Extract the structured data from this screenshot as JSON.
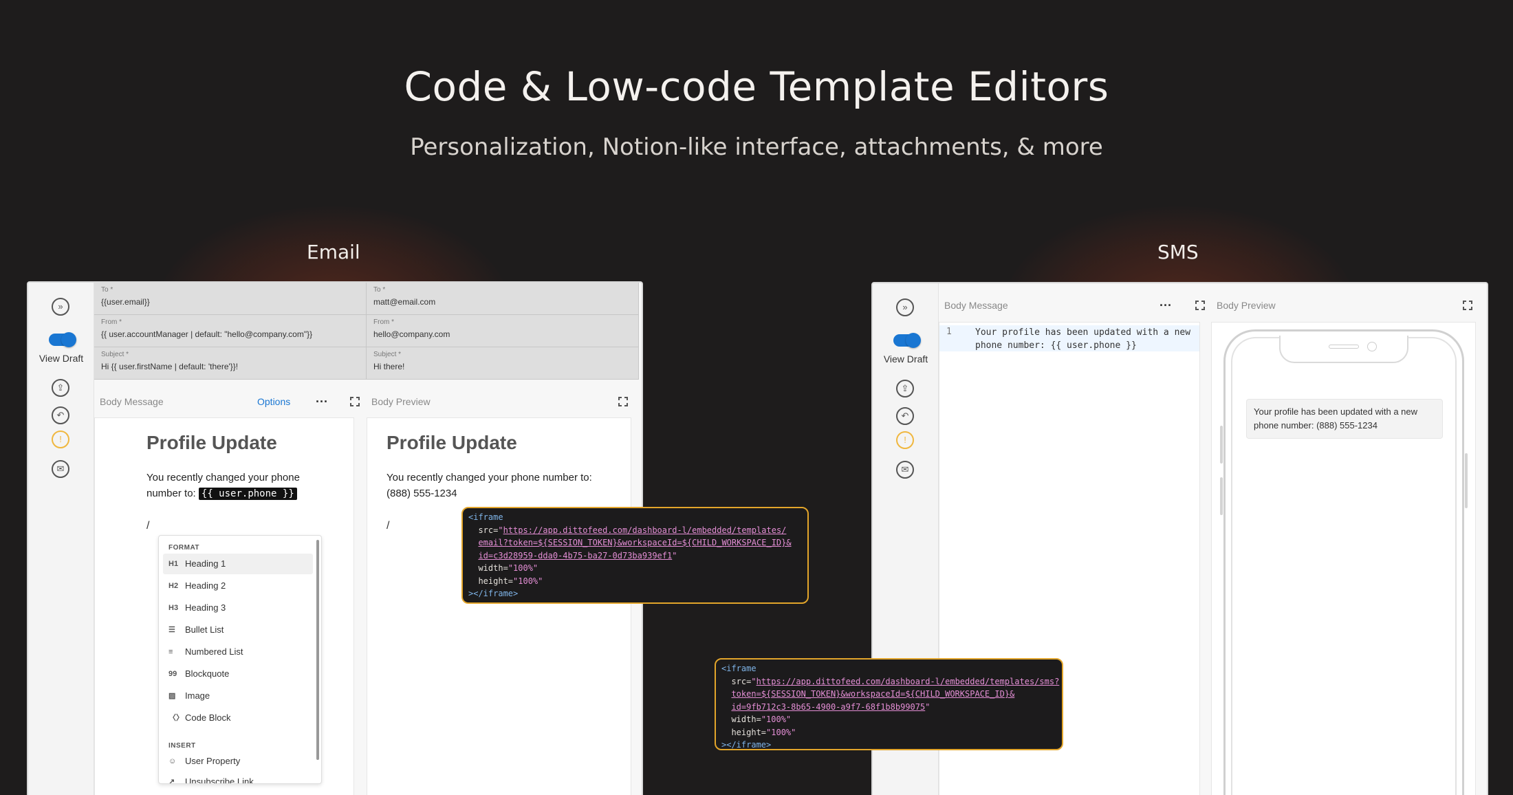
{
  "hero": {
    "title": "Code & Low-code Template Editors",
    "subtitle": "Personalization, Notion-like interface, attachments, & more"
  },
  "sections": {
    "email": "Email",
    "sms": "SMS"
  },
  "sidebar": {
    "view_draft_label": "View Draft",
    "icons": [
      "expand-sidebar-icon",
      "publish-icon",
      "revert-icon",
      "warning-icon",
      "send-test-icon"
    ]
  },
  "email": {
    "fields": {
      "to_label": "To *",
      "to_value": "{{user.email}}",
      "to_preview_label": "To *",
      "to_preview_value": "matt@email.com",
      "from_label": "From *",
      "from_value": "{{ user.accountManager | default: \"hello@company.com\"}}",
      "from_preview_label": "From *",
      "from_preview_value": "hello@company.com",
      "subject_label": "Subject *",
      "subject_value": "Hi {{ user.firstName | default: 'there'}}!",
      "subject_preview_label": "Subject *",
      "subject_preview_value": "Hi there!"
    },
    "body_label": "Body Message",
    "options_label": "Options",
    "more_label": "...",
    "preview_label": "Body Preview",
    "editor": {
      "title": "Profile Update",
      "text_line1": "You recently changed your phone",
      "text_line2_prefix": "number to:",
      "variable": "{{ user.phone }}",
      "slash": "/"
    },
    "preview": {
      "title": "Profile Update",
      "text_line1": "You recently changed your phone number to:",
      "text_line2": "(888) 555-1234",
      "slash": "/"
    },
    "menu": {
      "format_heading": "FORMAT",
      "items": [
        {
          "icon": "H1",
          "label": "Heading 1"
        },
        {
          "icon": "H2",
          "label": "Heading 2"
        },
        {
          "icon": "H3",
          "label": "Heading 3"
        },
        {
          "icon": "☰",
          "label": "Bullet List"
        },
        {
          "icon": "≡",
          "label": "Numbered List"
        },
        {
          "icon": "99",
          "label": "Blockquote"
        },
        {
          "icon": "▨",
          "label": "Image"
        },
        {
          "icon": "〈〉",
          "label": "Code Block"
        }
      ],
      "insert_heading": "INSERT",
      "insert_items": [
        {
          "icon": "☺",
          "label": "User Property"
        },
        {
          "icon": "↗",
          "label": "Unsubscribe Link"
        }
      ]
    },
    "embed_code": {
      "open_tag": "<iframe",
      "src_attr": "src=",
      "url_line1": "https://app.dittofeed.com/dashboard-l/embedded/templates/",
      "url_line2": "email?token=${SESSION_TOKEN}&workspaceId=${CHILD_WORKSPACE_ID}&",
      "url_line3": "id=c3d28959-dda0-4b75-ba27-0d73ba939ef1",
      "width_attr": "width=",
      "width_val": "\"100%\"",
      "height_attr": "height=",
      "height_val": "\"100%\"",
      "close_tag": "></iframe>"
    }
  },
  "sms": {
    "body_label": "Body Message",
    "more_label": "...",
    "preview_label": "Body Preview",
    "editor": {
      "line_number": "1",
      "line1": "Your profile has been updated with a new",
      "line2": "phone number: {{ user.phone }}"
    },
    "preview_message": "Your profile has been updated with a new phone number: (888) 555-1234",
    "embed_code": {
      "open_tag": "<iframe",
      "src_attr": "src=",
      "url_line1": "https://app.dittofeed.com/dashboard-l/embedded/templates/sms?",
      "url_line2": "token=${SESSION_TOKEN}&workspaceId=${CHILD_WORKSPACE_ID}&",
      "url_line3": "id=9fb712c3-8b65-4900-a9f7-68f1b8b99075",
      "width_attr": "width=",
      "width_val": "\"100%\"",
      "height_attr": "height=",
      "height_val": "\"100%\"",
      "close_tag": "></iframe>"
    }
  }
}
